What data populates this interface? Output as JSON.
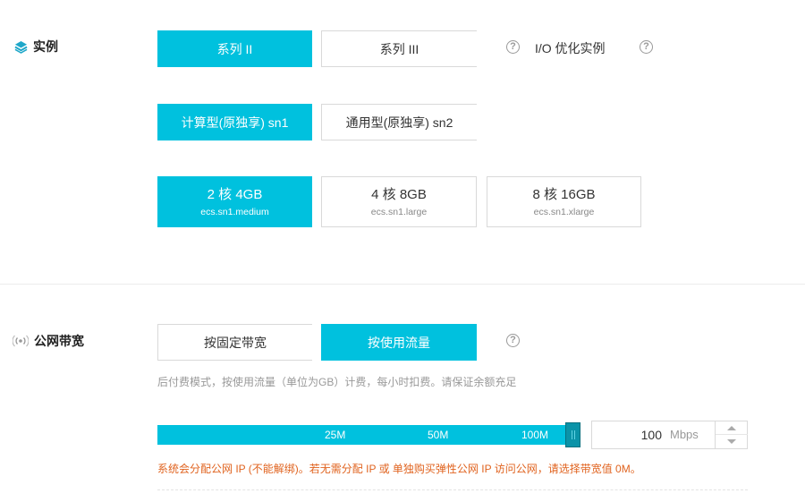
{
  "instance": {
    "label": "实例",
    "series": [
      {
        "label": "系列 II",
        "selected": true
      },
      {
        "label": "系列 III",
        "selected": false
      }
    ],
    "io_optimized_label": "I/O 优化实例",
    "families": [
      {
        "label": "计算型(原独享) sn1",
        "selected": true
      },
      {
        "label": "通用型(原独享) sn2",
        "selected": false
      }
    ],
    "specs": [
      {
        "main": "2 核 4GB",
        "sub": "ecs.sn1.medium",
        "selected": true
      },
      {
        "main": "4 核 8GB",
        "sub": "ecs.sn1.large",
        "selected": false
      },
      {
        "main": "8 核 16GB",
        "sub": "ecs.sn1.xlarge",
        "selected": false
      }
    ]
  },
  "bandwidth": {
    "label": "公网带宽",
    "modes": [
      {
        "label": "按固定带宽",
        "selected": false
      },
      {
        "label": "按使用流量",
        "selected": true
      }
    ],
    "description": "后付费模式，按使用流量（单位为GB）计费，每小时扣费。请保证余额充足",
    "slider": {
      "ticks": [
        "25M",
        "50M",
        "100M"
      ],
      "value": 100,
      "max": 100
    },
    "input_value": "100",
    "unit": "Mbps",
    "warning": "系统会分配公网 IP (不能解绑)。若无需分配 IP 或 单独购买弹性公网 IP 访问公网，请选择带宽值 0M。"
  },
  "colors": {
    "accent": "#00c1de",
    "handle": "#0b93a8",
    "warning": "#e0631f"
  }
}
